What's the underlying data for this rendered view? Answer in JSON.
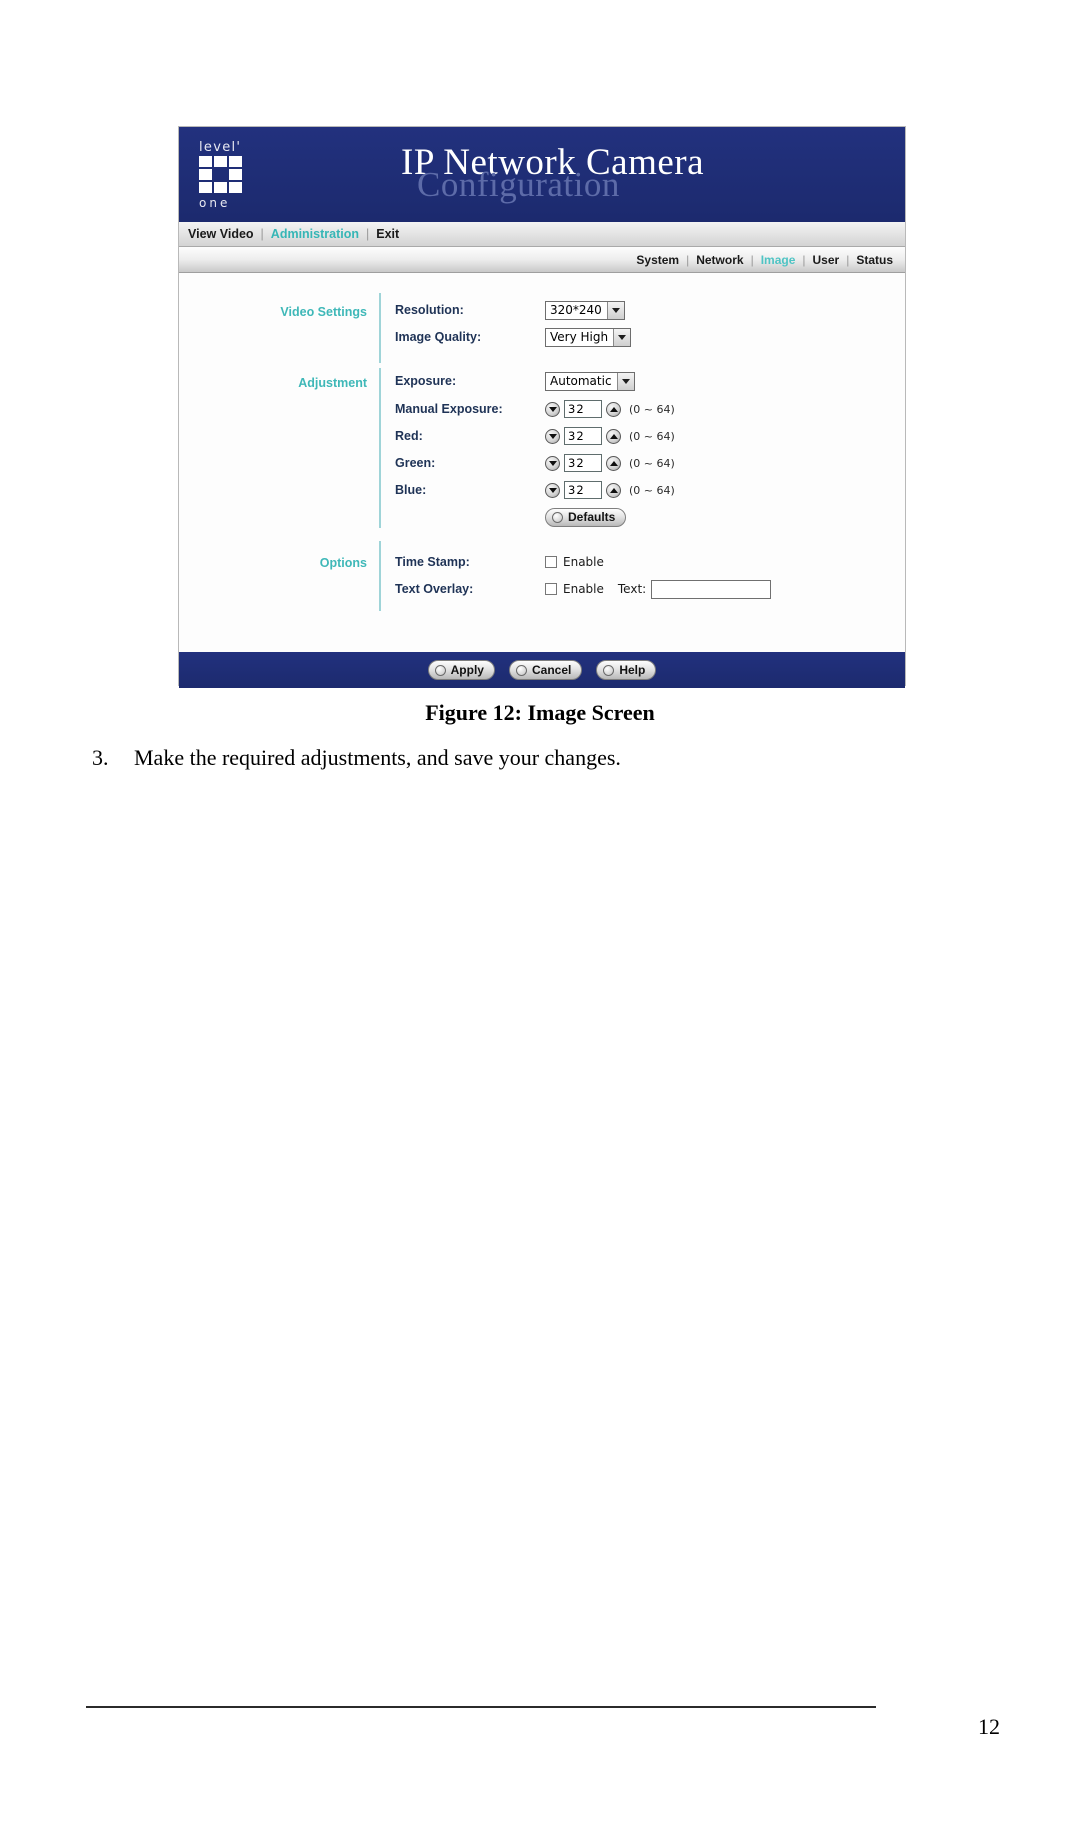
{
  "document": {
    "figure_caption": "Figure 12: Image Screen",
    "step_number": "3.",
    "step_text": "Make the required adjustments, and save your changes.",
    "page_number": "12"
  },
  "screenshot": {
    "brand": {
      "logo_top_word": "level'",
      "logo_bottom_word": "one"
    },
    "banner": {
      "title": "IP Network Camera",
      "subtitle": "Configuration"
    },
    "primary_nav": {
      "items": [
        {
          "label": "View Video",
          "active": false
        },
        {
          "label": "Administration",
          "active": true
        },
        {
          "label": "Exit",
          "active": false
        }
      ],
      "separator": "|"
    },
    "secondary_nav": {
      "items": [
        {
          "label": "System",
          "active": false
        },
        {
          "label": "Network",
          "active": false
        },
        {
          "label": "Image",
          "active": true
        },
        {
          "label": "User",
          "active": false
        },
        {
          "label": "Status",
          "active": false
        }
      ],
      "separator": "|"
    },
    "sections": {
      "video_settings": {
        "title": "Video Settings",
        "resolution": {
          "label": "Resolution:",
          "value": "320*240"
        },
        "image_quality": {
          "label": "Image Quality:",
          "value": "Very High"
        }
      },
      "adjustment": {
        "title": "Adjustment",
        "exposure": {
          "label": "Exposure:",
          "value": "Automatic"
        },
        "spinners": [
          {
            "label": "Manual Exposure:",
            "value": "32",
            "range": "(0 ~ 64)"
          },
          {
            "label": "Red:",
            "value": "32",
            "range": "(0 ~ 64)"
          },
          {
            "label": "Green:",
            "value": "32",
            "range": "(0 ~ 64)"
          },
          {
            "label": "Blue:",
            "value": "32",
            "range": "(0 ~ 64)"
          }
        ],
        "defaults_button": "Defaults"
      },
      "options": {
        "title": "Options",
        "time_stamp": {
          "label": "Time Stamp:",
          "enable_label": "Enable",
          "checked": false
        },
        "text_overlay": {
          "label": "Text Overlay:",
          "enable_label": "Enable",
          "checked": false,
          "text_label": "Text:",
          "text_value": ""
        }
      }
    },
    "footer_buttons": [
      {
        "label": "Apply"
      },
      {
        "label": "Cancel"
      },
      {
        "label": "Help"
      }
    ],
    "colors": {
      "banner_blue": "#1f2f7a",
      "accent_teal": "#3fb8b8",
      "label_navy": "#1f3356"
    }
  }
}
